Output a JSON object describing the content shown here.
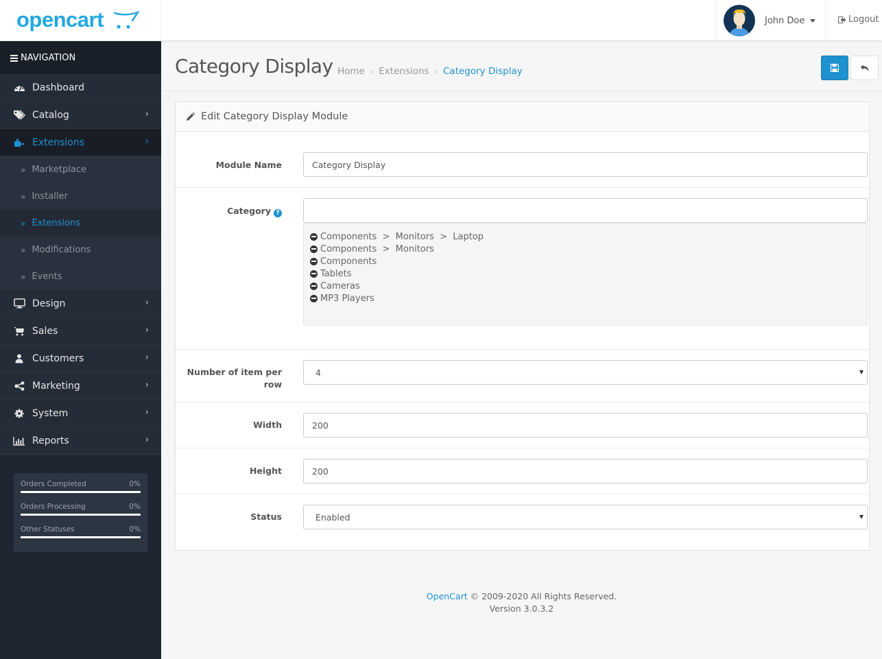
{
  "header": {
    "logo_text": "opencart",
    "user_name": "John Doe",
    "logout_label": "Logout"
  },
  "sidebar": {
    "nav_title": "NAVIGATION",
    "items": [
      {
        "label": "Dashboard",
        "icon": "dashboard-icon",
        "has_children": false
      },
      {
        "label": "Catalog",
        "icon": "tags-icon",
        "has_children": true
      },
      {
        "label": "Extensions",
        "icon": "puzzle-icon",
        "has_children": true,
        "active": true,
        "children": [
          {
            "label": "Marketplace"
          },
          {
            "label": "Installer"
          },
          {
            "label": "Extensions",
            "active": true
          },
          {
            "label": "Modifications"
          },
          {
            "label": "Events"
          }
        ]
      },
      {
        "label": "Design",
        "icon": "desktop-icon",
        "has_children": true
      },
      {
        "label": "Sales",
        "icon": "shopping-cart-icon",
        "has_children": true
      },
      {
        "label": "Customers",
        "icon": "user-icon",
        "has_children": true
      },
      {
        "label": "Marketing",
        "icon": "share-icon",
        "has_children": true
      },
      {
        "label": "System",
        "icon": "cog-icon",
        "has_children": true
      },
      {
        "label": "Reports",
        "icon": "bar-chart-icon",
        "has_children": true
      }
    ],
    "stats": [
      {
        "label": "Orders Completed",
        "value": "0%",
        "fraction": 0
      },
      {
        "label": "Orders Processing",
        "value": "0%",
        "fraction": 0
      },
      {
        "label": "Other Statuses",
        "value": "0%",
        "fraction": 0
      }
    ]
  },
  "page": {
    "title": "Category Display",
    "breadcrumb": [
      "Home",
      "Extensions",
      "Category Display"
    ],
    "save_tooltip": "Save",
    "back_tooltip": "Back"
  },
  "panel": {
    "heading": "Edit Category Display Module",
    "fields": {
      "module_name": {
        "label": "Module Name",
        "value": "Category Display"
      },
      "category": {
        "label": "Category",
        "value": "",
        "selected": [
          "Components  >  Monitors  >  Laptop",
          "Components  >  Monitors",
          "Components",
          "Tablets",
          "Cameras",
          "MP3 Players"
        ]
      },
      "items_per_row": {
        "label": "Number of item per row",
        "value": "4"
      },
      "width": {
        "label": "Width",
        "value": "200"
      },
      "height": {
        "label": "Height",
        "value": "200"
      },
      "status": {
        "label": "Status",
        "value": "Enabled"
      }
    }
  },
  "footer": {
    "link": "OpenCart",
    "copyright": " © 2009-2020 All Rights Reserved.",
    "version": "Version 3.0.3.2"
  },
  "colors": {
    "accent": "#1e91cf",
    "sidebar_bg": "#1e2630",
    "logo": "#23a8e0"
  }
}
